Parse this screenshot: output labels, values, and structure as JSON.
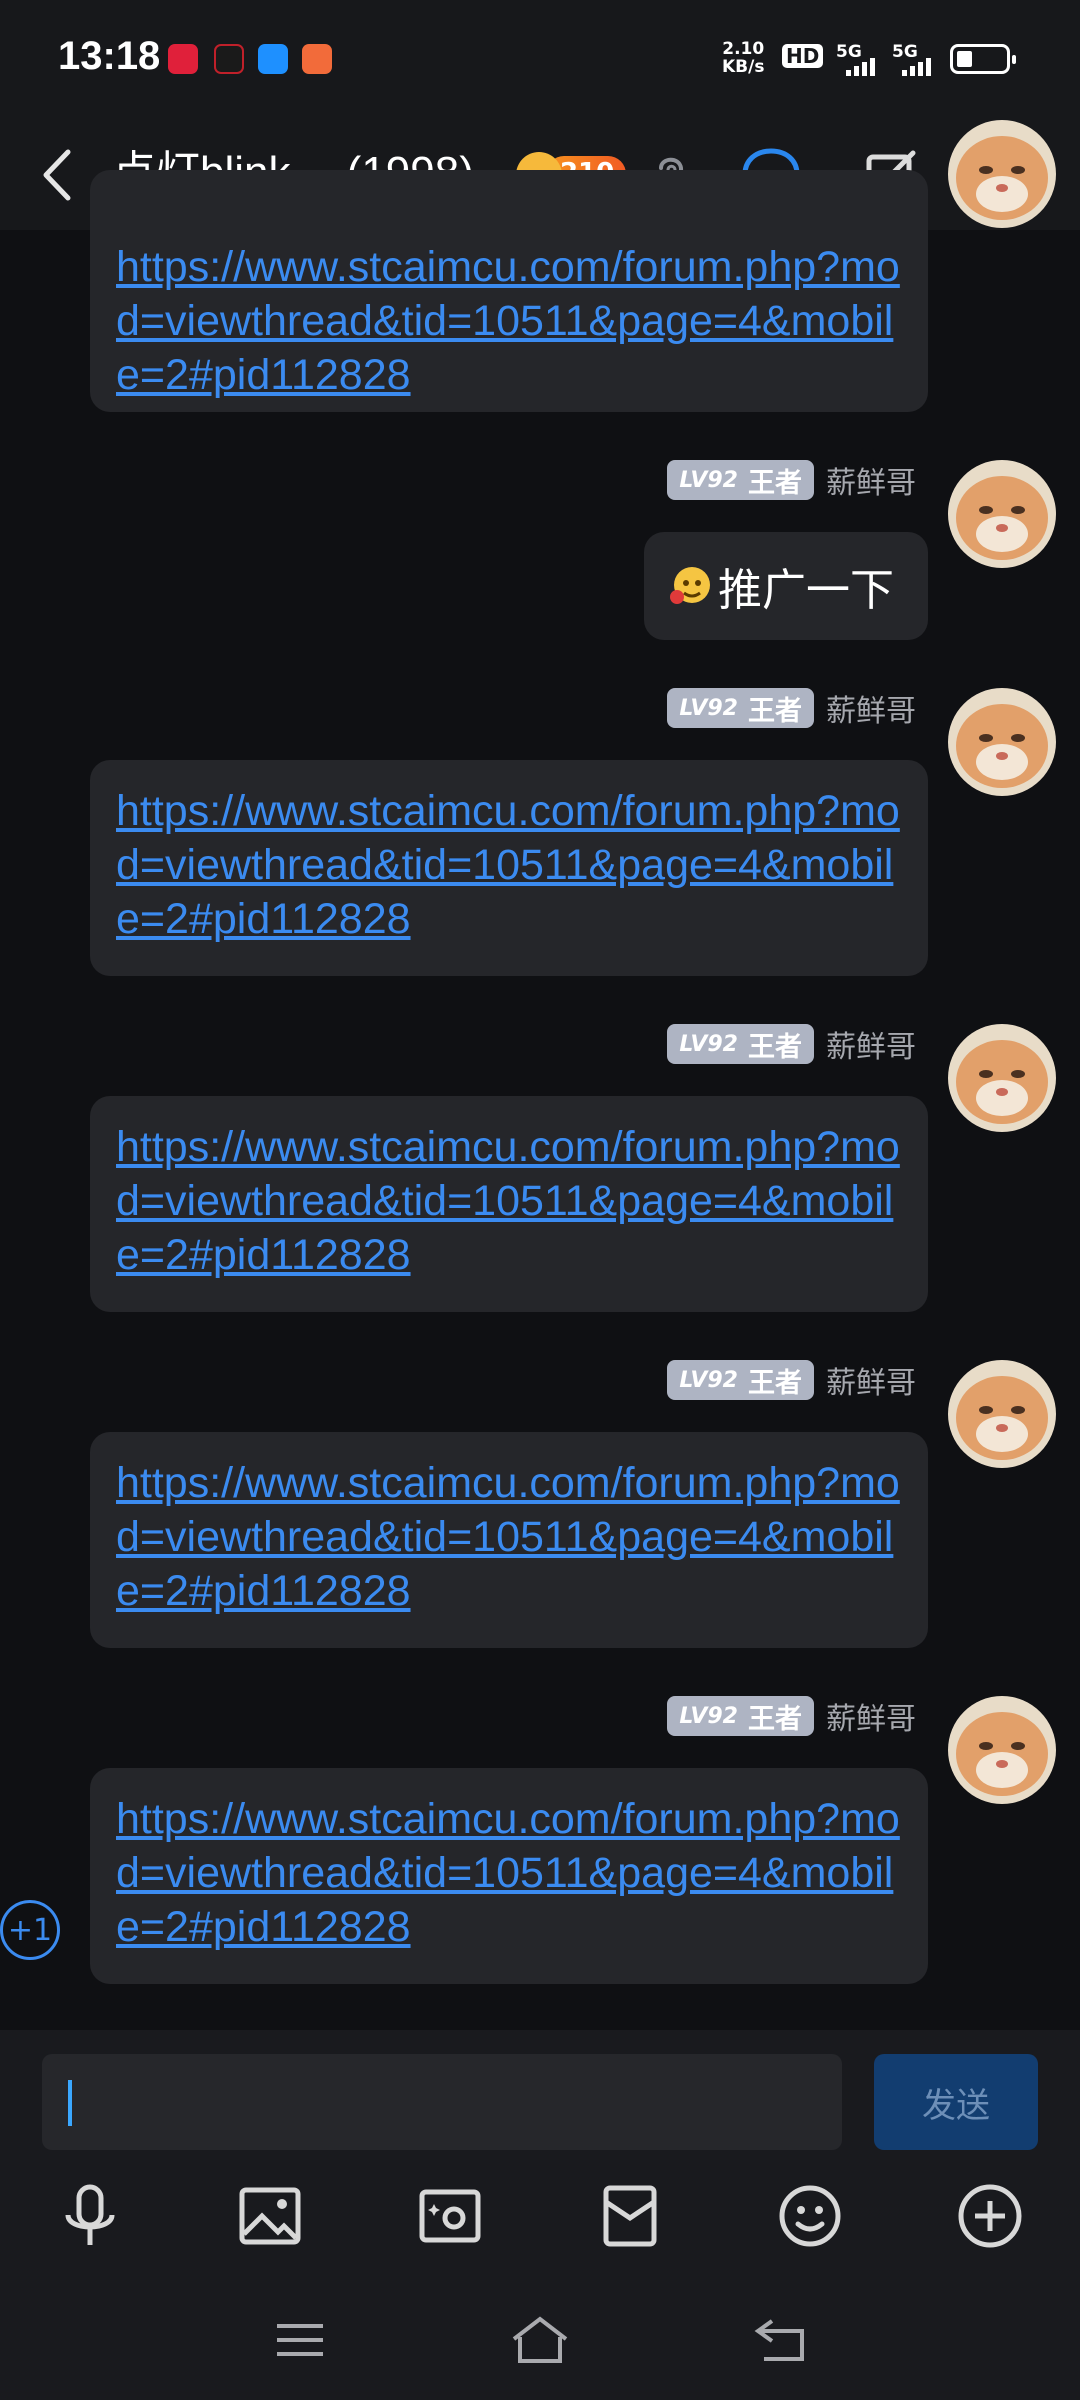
{
  "status_bar": {
    "time": "13:18",
    "net_speed_value": "2.10",
    "net_speed_unit": "KB/s",
    "hd": "HD",
    "sig1": "5G",
    "sig2": "5G",
    "battery_level": 0.33
  },
  "header": {
    "title": "点灯blink··· (1998)",
    "fire_count": "210"
  },
  "messages": [
    {
      "link": "https://www.stcaimcu.com/forum.php?mod=viewthread&tid=10511&page=4&mobile=2#pid112828"
    },
    {
      "level": "LV92",
      "rank": "王者",
      "nick": "薪鲜哥",
      "text": "推广一下"
    },
    {
      "level": "LV92",
      "rank": "王者",
      "nick": "薪鲜哥",
      "link": "https://www.stcaimcu.com/forum.php?mod=viewthread&tid=10511&page=4&mobile=2#pid112828"
    },
    {
      "level": "LV92",
      "rank": "王者",
      "nick": "薪鲜哥",
      "link": "https://www.stcaimcu.com/forum.php?mod=viewthread&tid=10511&page=4&mobile=2#pid112828"
    },
    {
      "level": "LV92",
      "rank": "王者",
      "nick": "薪鲜哥",
      "link": "https://www.stcaimcu.com/forum.php?mod=viewthread&tid=10511&page=4&mobile=2#pid112828"
    },
    {
      "level": "LV92",
      "rank": "王者",
      "nick": "薪鲜哥",
      "link": "https://www.stcaimcu.com/forum.php?mod=viewthread&tid=10511&page=4&mobile=2#pid112828"
    }
  ],
  "plus_one": "+1",
  "input": {
    "value": "",
    "send_label": "发送"
  },
  "colors": {
    "accent": "#2a87ee",
    "link": "#3b8bf0",
    "bubble": "#25262a",
    "background": "#0f1013"
  }
}
